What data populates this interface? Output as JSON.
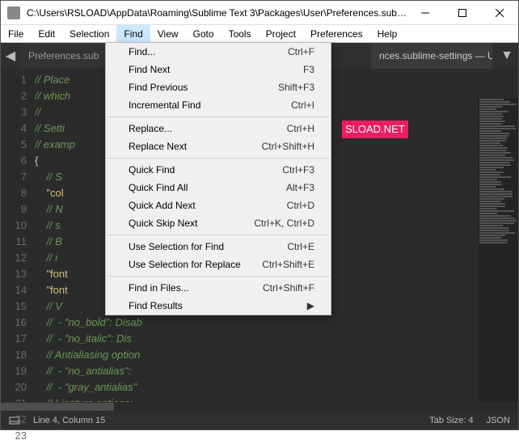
{
  "window": {
    "title": "C:\\Users\\RSLOAD\\AppData\\Roaming\\Sublime Text 3\\Packages\\User\\Preferences.subli..."
  },
  "menu": {
    "items": [
      "File",
      "Edit",
      "Selection",
      "Find",
      "View",
      "Goto",
      "Tools",
      "Project",
      "Preferences",
      "Help"
    ],
    "active_index": 3
  },
  "find_menu": {
    "groups": [
      [
        {
          "label": "Find...",
          "shortcut": "Ctrl+F"
        },
        {
          "label": "Find Next",
          "shortcut": "F3"
        },
        {
          "label": "Find Previous",
          "shortcut": "Shift+F3"
        },
        {
          "label": "Incremental Find",
          "shortcut": "Ctrl+I"
        }
      ],
      [
        {
          "label": "Replace...",
          "shortcut": "Ctrl+H"
        },
        {
          "label": "Replace Next",
          "shortcut": "Ctrl+Shift+H"
        }
      ],
      [
        {
          "label": "Quick Find",
          "shortcut": "Ctrl+F3"
        },
        {
          "label": "Quick Find All",
          "shortcut": "Alt+F3"
        },
        {
          "label": "Quick Add Next",
          "shortcut": "Ctrl+D"
        },
        {
          "label": "Quick Skip Next",
          "shortcut": "Ctrl+K, Ctrl+D"
        }
      ],
      [
        {
          "label": "Use Selection for Find",
          "shortcut": "Ctrl+E"
        },
        {
          "label": "Use Selection for Replace",
          "shortcut": "Ctrl+Shift+E"
        }
      ],
      [
        {
          "label": "Find in Files...",
          "shortcut": "Ctrl+Shift+F"
        },
        {
          "label": "Find Results",
          "submenu": true
        }
      ]
    ]
  },
  "tabs": {
    "left_hidden": "Preferences.sub",
    "right_visible": "nces.sublime-settings — User"
  },
  "code": {
    "start_line": 1,
    "lines": [
      {
        "t": "cmt",
        "text": "// Place                          ttings in here overri"
      },
      {
        "t": "cmt",
        "text": "// which                          d are overridden in t"
      },
      {
        "t": "cmt",
        "text": "//"
      },
      {
        "t": "cmt",
        "text": "// Setti"
      },
      {
        "t": "cmt",
        "text": "// examp"
      },
      {
        "t": "brace",
        "text": "{"
      },
      {
        "t": "cmt",
        "text": "    // S"
      },
      {
        "t": "key",
        "text": "    \"col"
      },
      {
        "t": "",
        "text": ""
      },
      {
        "t": "cmt",
        "text": "    // N"
      },
      {
        "t": "cmt",
        "text": "    // s"
      },
      {
        "t": "cmt",
        "text": "    // B"
      },
      {
        "t": "cmt",
        "text": "    // i"
      },
      {
        "t": "key",
        "text": "    \"font"
      },
      {
        "t": "key",
        "text": "    \"font"
      },
      {
        "t": "",
        "text": ""
      },
      {
        "t": "cmt",
        "text": "    // V"
      },
      {
        "t": "cmt",
        "text": "    //  - \"no_bold\": Disab"
      },
      {
        "t": "cmt",
        "text": "    //  - \"no_italic\": Dis"
      },
      {
        "t": "cmt",
        "text": "    // Antialiasing option"
      },
      {
        "t": "cmt",
        "text": "    //  - \"no_antialias\": "
      },
      {
        "t": "cmt",
        "text": "    //  - \"gray_antialias\""
      },
      {
        "t": "cmt",
        "text": "    // Ligature options:"
      }
    ],
    "badge_text": "SLOAD.NET"
  },
  "status": {
    "cursor": "Line 4, Column 15",
    "tab_size": "Tab Size: 4",
    "syntax": "JSON"
  }
}
